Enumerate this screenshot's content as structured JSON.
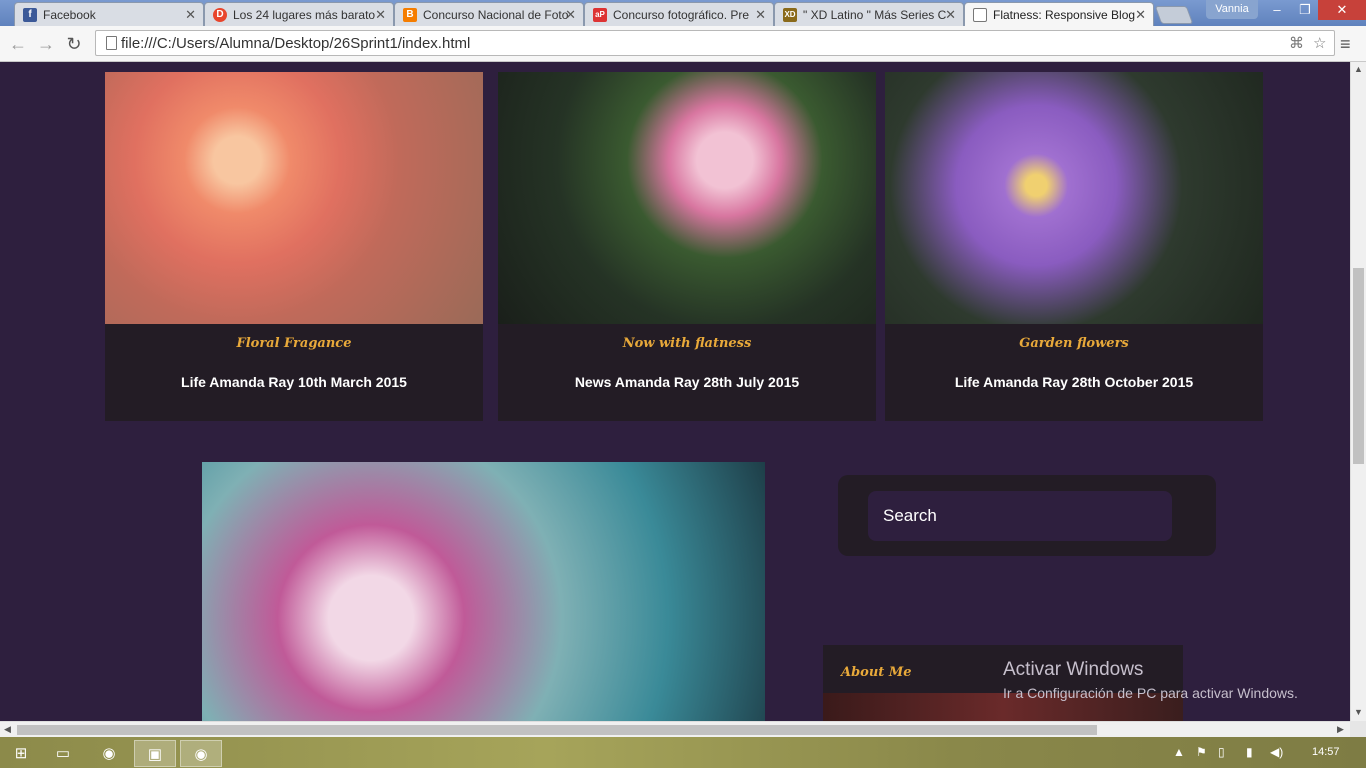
{
  "browser": {
    "tabs": [
      {
        "title": "Facebook",
        "favicon": "facebook-icon",
        "color": "#3b5998",
        "glyph": "f"
      },
      {
        "title": "Los 24 lugares más barato",
        "favicon": "despegar-icon",
        "color": "#e8452c",
        "glyph": "D"
      },
      {
        "title": "Concurso Nacional de Foto",
        "favicon": "blogger-icon",
        "color": "#f57d00",
        "glyph": "B"
      },
      {
        "title": "Concurso fotográfico. Pre",
        "favicon": "app-icon",
        "color": "#d33",
        "glyph": "aP"
      },
      {
        "title": "\" XD Latino \" Más Series C",
        "favicon": "xd-icon",
        "color": "#8a6a1a",
        "glyph": "XD"
      },
      {
        "title": "Flatness: Responsive Blog",
        "favicon": "page-icon",
        "color": "#888",
        "glyph": ""
      }
    ],
    "user": "Vannia",
    "url": "file:///C:/Users/Alumna/Desktop/26Sprint1/index.html"
  },
  "page": {
    "cards": [
      {
        "title": "Floral Fragance",
        "meta": "Life Amanda Ray 10th March 2015"
      },
      {
        "title": "Now with flatness",
        "meta": "News Amanda Ray 28th July 2015"
      },
      {
        "title": "Garden flowers",
        "meta": "Life Amanda Ray 28th October 2015"
      }
    ],
    "search_placeholder": "Search",
    "about_title": "About Me",
    "watermark_title": "Activar Windows",
    "watermark_sub": "Ir a Configuración de PC para activar Windows."
  },
  "taskbar": {
    "clock": "14:57"
  },
  "colors": {
    "page_bg": "#2e1f3e",
    "card_bg": "#231c25",
    "accent": "#e8a93a"
  }
}
